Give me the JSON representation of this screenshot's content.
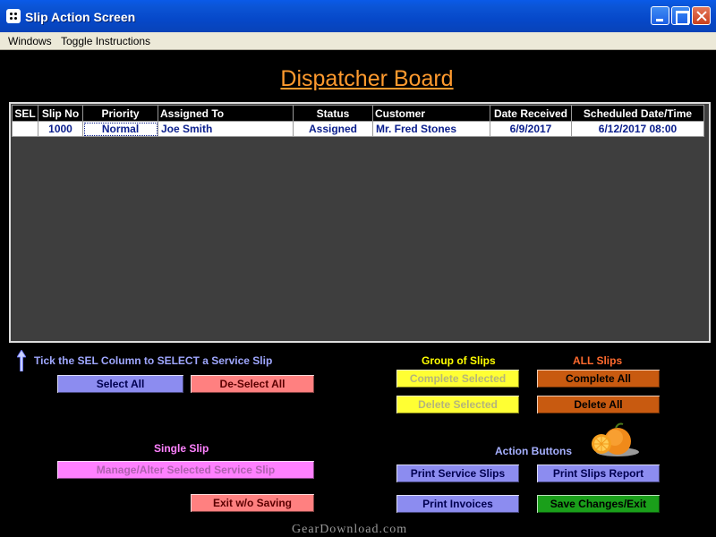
{
  "window": {
    "title": "Slip Action Screen"
  },
  "menu": [
    "Windows",
    "Toggle Instructions"
  ],
  "board_title": "Dispatcher Board",
  "grid": {
    "columns": [
      "SEL",
      "Slip No",
      "Priority",
      "Assigned To",
      "Status",
      "Customer",
      "Date Received",
      "Scheduled Date/Time"
    ],
    "rows": [
      [
        "",
        "1000",
        "Normal",
        "Joe Smith",
        "Assigned",
        "Mr. Fred Stones",
        "6/9/2017",
        "6/12/2017 08:00"
      ]
    ]
  },
  "hint": "Tick the SEL Column to SELECT a Service Slip",
  "labels": {
    "group": "Group of Slips",
    "all": "ALL Slips",
    "single": "Single Slip",
    "actions": "Action Buttons"
  },
  "buttons": {
    "select_all": "Select All",
    "deselect_all": "De-Select All",
    "complete_selected": "Complete Selected",
    "delete_selected": "Delete Selected",
    "complete_all": "Complete All",
    "delete_all": "Delete All",
    "manage_selected": "Manage/Alter Selected Service Slip",
    "exit_no_save": "Exit w/o Saving",
    "print_service_slips": "Print Service Slips",
    "print_slips_report": "Print Slips Report",
    "print_invoices": "Print Invoices",
    "save_changes_exit": "Save Changes/Exit"
  },
  "colors": {
    "title_accent": "#ff9a2e",
    "group_label": "#ffff00",
    "all_label": "#ff6a2e",
    "single_label": "#ff82ff",
    "action_label": "#a6b0ff"
  },
  "watermark": "GearDownload.com"
}
